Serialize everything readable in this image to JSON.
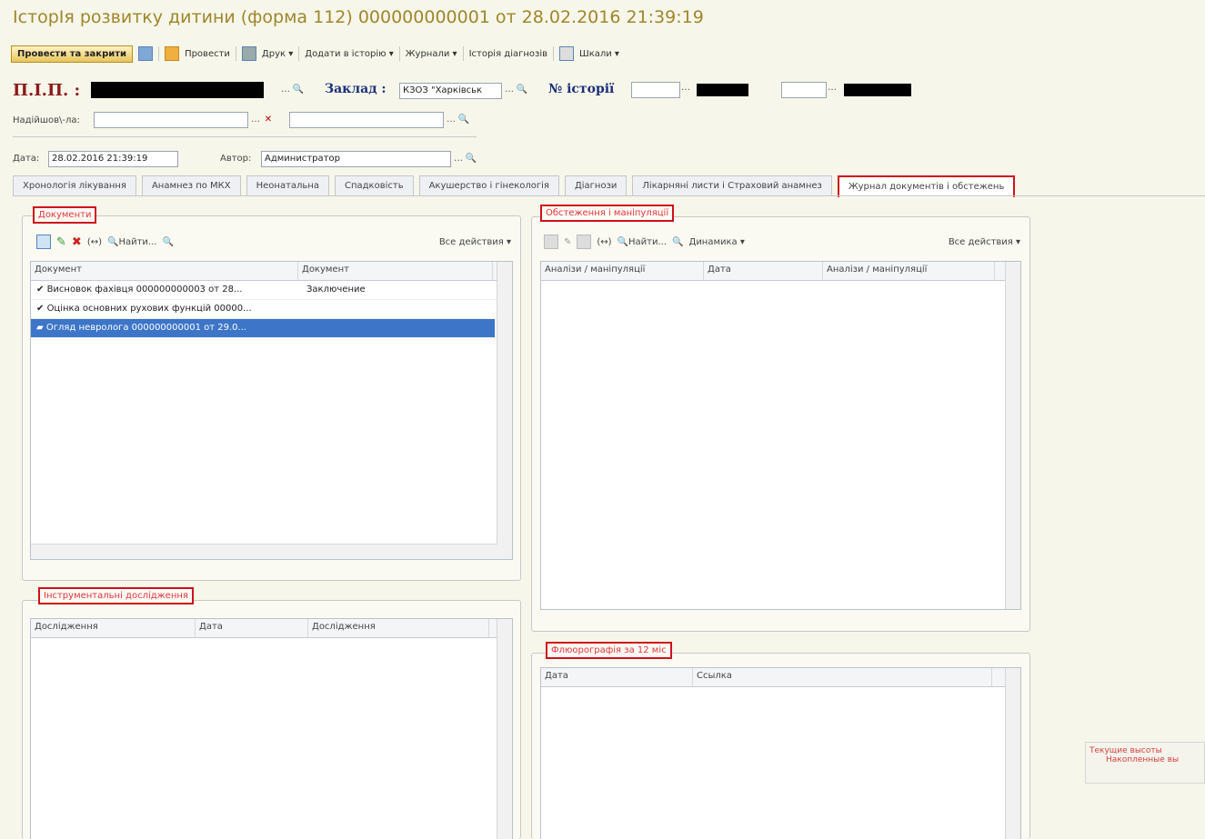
{
  "window": {
    "title": "ІсторІя розвитку дитини (форма 112) 000000000001 от 28.02.2016 21:39:19"
  },
  "toolbar": {
    "main_button": "Провести та закрити",
    "items": [
      "Провести",
      "Друк ▾",
      "Додати в історію ▾",
      "Журнали ▾",
      "Історія діагнозів",
      "Шкали ▾"
    ]
  },
  "header": {
    "pib_label": "П.І.П. :",
    "zaklad_label": "Заклад :",
    "zaklad_value": "КЗОЗ \"Харківськ",
    "history_label": "№ історії",
    "nadiyshov_label": "Надійшов\\-ла:",
    "date_label": "Дата:",
    "date_value": "28.02.2016 21:39:19",
    "author_label": "Автор:",
    "author_value": "Администратор"
  },
  "tabs": [
    {
      "label": "Хронологія лікування"
    },
    {
      "label": "Анамнез по МКХ"
    },
    {
      "label": "Неонатальна"
    },
    {
      "label": "Спадковість"
    },
    {
      "label": "Акушерство і гінекологія"
    },
    {
      "label": "Діагнози"
    },
    {
      "label": "Лікарняні листи і Страховий анамнез"
    },
    {
      "label": "Журнал документів і обстежень"
    }
  ],
  "documents": {
    "legend": "Документи",
    "find": "Найти...",
    "all_actions": "Все действия ▾",
    "columns": [
      "Документ",
      "Документ"
    ],
    "rows": [
      {
        "doc": "Висновок фахівця 000000000003 от 28...",
        "type": "Заключение"
      },
      {
        "doc": "Оцінка основних рухових функцій 00000...",
        "type": ""
      },
      {
        "doc": "Огляд невролога 000000000001 от 29.0...",
        "type": ""
      }
    ]
  },
  "exams": {
    "legend": "Обстеження і маніпуляції",
    "find": "Найти...",
    "dynamics": "Динамика ▾",
    "all_actions": "Все действия ▾",
    "columns": [
      "Аналізи / маніпуляції",
      "Дата",
      "Аналізи / маніпуляції"
    ]
  },
  "instrumental": {
    "legend": "Інструментальні дослідження",
    "columns": [
      "Дослідження",
      "Дата",
      "Дослідження"
    ]
  },
  "fluoro": {
    "legend": "Флюорографія за 12 міс",
    "columns": [
      "Дата",
      "Ссылка"
    ]
  },
  "side_info": {
    "line1": "Текущие высоты",
    "line2": "Накопленные вы"
  },
  "colors": {
    "accent_red": "#d0101a",
    "title_gold": "#a0862b",
    "selection": "#3d75c8"
  }
}
